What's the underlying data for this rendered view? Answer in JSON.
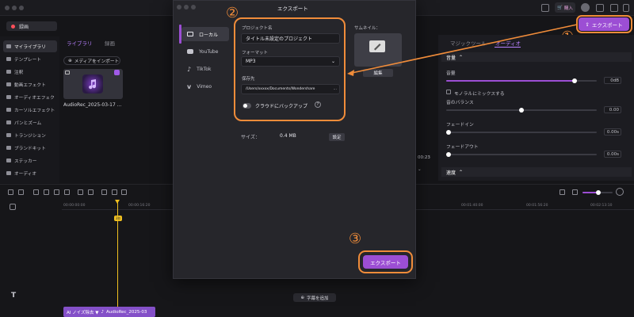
{
  "topbar": {
    "buy_label": "購入",
    "export_label": "エクスポート"
  },
  "left": {
    "record_label": "録画",
    "sidebar": [
      {
        "label": "マイライブラリ",
        "icon": "library-icon",
        "active": true
      },
      {
        "label": "テンプレート",
        "icon": "template-icon"
      },
      {
        "label": "注釈",
        "icon": "annotation-icon"
      },
      {
        "label": "動画エフェクト",
        "icon": "video-effect-icon"
      },
      {
        "label": "オーディオエフェク",
        "icon": "audio-effect-icon"
      },
      {
        "label": "カーソルエフェクト",
        "icon": "cursor-effect-icon"
      },
      {
        "label": "パンとズーム",
        "icon": "pan-zoom-icon"
      },
      {
        "label": "トランジション",
        "icon": "transition-icon"
      },
      {
        "label": "ブランドキット",
        "icon": "brand-kit-icon"
      },
      {
        "label": "ステッカー",
        "icon": "sticker-icon"
      },
      {
        "label": "オーディオ",
        "icon": "audio-icon"
      }
    ],
    "tabs": [
      "ライブラリ",
      "録画"
    ],
    "import_label": "メディアをインポート",
    "media_name": "AudioRec_2025-03-17 ..."
  },
  "right": {
    "tabs": [
      "マジックツール",
      "オーディオ"
    ],
    "section_audio": "音量",
    "volume_label": "音量",
    "volume_value": "0dB",
    "volume_level": 0.85,
    "mix_mono_label": "モノラルにミックスする",
    "balance_label": "音のバランス",
    "balance_value": "0.00",
    "fadein_label": "フェードイン",
    "fadein_value": "0.00s",
    "fadeout_label": "フェードアウト",
    "fadeout_value": "0.00s",
    "section_speed": "速度",
    "behind_time": "00:23"
  },
  "dialog": {
    "title": "エクスポート",
    "side_items": [
      {
        "label": "ローカル",
        "icon": "local-icon",
        "active": true
      },
      {
        "label": "YouTube",
        "icon": "youtube-icon"
      },
      {
        "label": "TikTok",
        "icon": "tiktok-icon"
      },
      {
        "label": "Vimeo",
        "icon": "vimeo-icon"
      }
    ],
    "project_name_label": "プロジェクト名",
    "project_name": "タイトル未設定のプロジェクト",
    "format_label": "フォーマット",
    "format_value": "MP3",
    "save_to_label": "保存先",
    "save_to_value": "/Users/xxxxx/Documents/Wondershare",
    "cloud_backup_label": "クラウドにバックアップ",
    "thumbnail_label": "サムネイル：",
    "edit_label": "編集",
    "size_label": "サイズ：",
    "size_value": "0.4 MB",
    "settings_label": "設定",
    "export_label": "エクスポート"
  },
  "timeline": {
    "ruler_labels": [
      "00:00:00:00",
      "00:00:16:20",
      "00:01:40:00",
      "00:01:56:20",
      "00:02:13:10"
    ],
    "playhead_label": "3秒",
    "clip_label": "AI ノイズ除去 ▼",
    "clip_name": "AudioRec_2025-03",
    "add_subtitle_label": "字幕を追加",
    "text_track_icon": "T"
  },
  "annotations": {
    "n1": "①",
    "n2": "②",
    "n3": "③",
    "accent_color": "#f08c3a"
  },
  "colors": {
    "accent": "#9c4ed4",
    "annotation": "#f08c3a",
    "background": "#151518"
  }
}
